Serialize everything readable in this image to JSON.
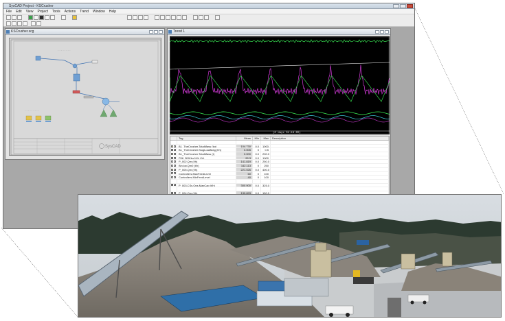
{
  "window": {
    "title": "SysCAD Project - KSCrusher",
    "close_label": "✕"
  },
  "menu": [
    "File",
    "Edit",
    "View",
    "Project",
    "Tools",
    "Actions",
    "Trend",
    "Window",
    "Help"
  ],
  "flowsheet": {
    "title": "KSCrusher.scg",
    "logo_text": "SysCAD"
  },
  "trend": {
    "title": "Trend 1",
    "time_label": "(0 days 01:19:05)",
    "table": {
      "headers": [
        "Tag",
        "Meas",
        "Min",
        "Max",
        "Description"
      ],
      "rows": [
        {
          "tag": "",
          "meas": "",
          "min": "",
          "max": ""
        },
        {
          "tag": "B1_TheCrusher.TotalMass (kg)",
          "meas": "104.730",
          "min": "0.0",
          "max": "1000."
        },
        {
          "tag": "B1_TheCrusher.SlugLoadMag (t/h)",
          "meas": "0.005",
          "min": "0",
          "max": "0.5"
        },
        {
          "tag": "B1_TheCrusher.TotalMass (t)",
          "meas": "0.000",
          "min": "0.0",
          "max": "200.0"
        },
        {
          "tag": "P06_BOKlev%% (%)",
          "meas": "99.3",
          "min": "0.0",
          "max": "1000"
        },
        {
          "tag": "P_002.Qm (t/h)",
          "meas": "141.819",
          "min": "0.0",
          "max": "250.0"
        },
        {
          "tag": "Bin.kw.Qm0 (t/h)",
          "meas": "142.113",
          "min": "0",
          "max": "250"
        },
        {
          "tag": "P_005.Qm (t/h)",
          "meas": "221.026",
          "min": "0.0",
          "max": "400.0"
        },
        {
          "tag": "Controllers.MaxFeedLevel",
          "meas": "60",
          "min": "0",
          "max": "100"
        },
        {
          "tag": "Controllers.MinFeedLevel",
          "meas": "40",
          "min": "0",
          "max": "100"
        },
        {
          "tag": "",
          "meas": "",
          "min": "",
          "max": ""
        },
        {
          "tag": "P_003.CSs.Ops.MaxCap (t/h)",
          "meas": "300.000",
          "min": "0.0",
          "max": "325.0"
        },
        {
          "tag": "",
          "meas": "",
          "min": "",
          "max": ""
        },
        {
          "tag": "P_004.Qm (t/h)",
          "meas": "139.893",
          "min": "0.0",
          "max": "150.0"
        },
        {
          "tag": "",
          "meas": "",
          "min": "",
          "max": ""
        },
        {
          "tag": "Controllers.CalibrationStep",
          "meas": "0",
          "min": "0",
          "max": "10"
        },
        {
          "tag": "",
          "meas": "",
          "min": "",
          "max": ""
        },
        {
          "tag": "P_004.Qm (t/h)",
          "meas": "211.220",
          "min": "0.00",
          "max": "1200."
        }
      ]
    }
  },
  "colors": {
    "trend_bg": "#000000",
    "series_green": "#33d04a",
    "series_magenta": "#d23ad8",
    "series_white": "#e8e8e8",
    "series_cyan": "#3fd0e0"
  },
  "photo": {
    "description_visible_text": ""
  }
}
